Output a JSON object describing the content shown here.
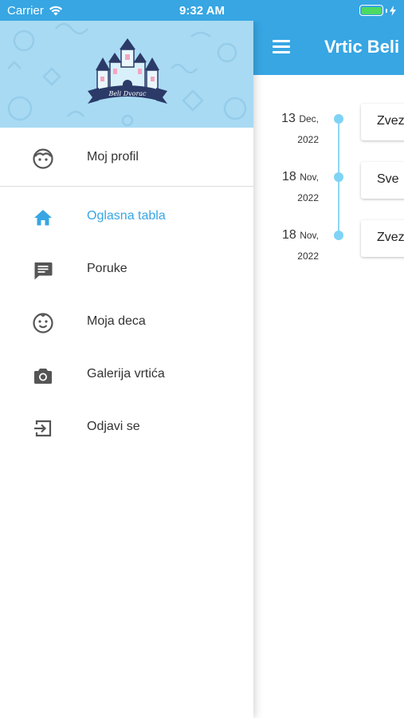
{
  "status_bar": {
    "carrier": "Carrier",
    "time": "9:32 AM"
  },
  "app_bar": {
    "title": "Vrtic Beli"
  },
  "timeline": [
    {
      "day": "13",
      "month": "Dec,",
      "year": "2022",
      "card_text": "Zvez"
    },
    {
      "day": "18",
      "month": "Nov,",
      "year": "2022",
      "card_text": "Sve"
    },
    {
      "day": "18",
      "month": "Nov,",
      "year": "2022",
      "card_text": "Zvez"
    }
  ],
  "drawer": {
    "logo_text": "Beli Dvorac",
    "profile": {
      "label": "Moj profil",
      "icon": "face-icon"
    },
    "items": [
      {
        "label": "Oglasna tabla",
        "icon": "home-icon",
        "active": true
      },
      {
        "label": "Poruke",
        "icon": "message-icon",
        "active": false
      },
      {
        "label": "Moja deca",
        "icon": "child-face-icon",
        "active": false
      },
      {
        "label": "Galerija vrtića",
        "icon": "camera-icon",
        "active": false
      },
      {
        "label": "Odjavi se",
        "icon": "logout-icon",
        "active": false
      }
    ]
  },
  "colors": {
    "primary": "#37a6e3",
    "header_bg": "#a9daf3",
    "timeline": "#7fd3f5",
    "icon": "#555555",
    "battery": "#4cd964"
  }
}
